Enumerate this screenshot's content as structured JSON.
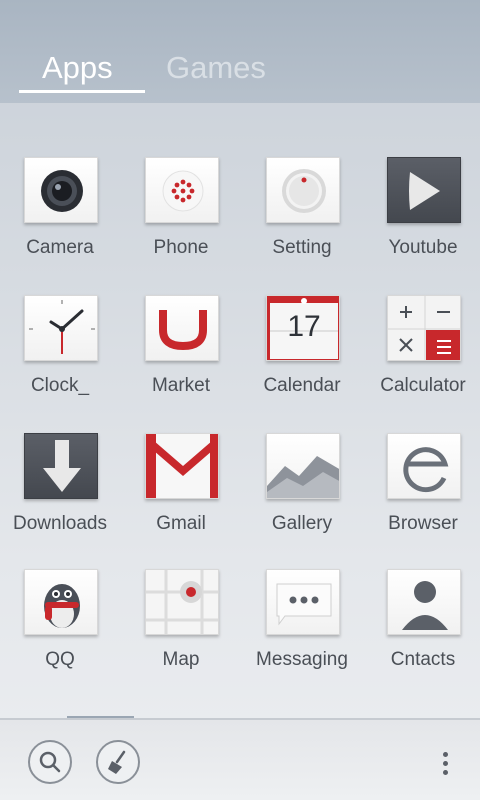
{
  "tabs": [
    {
      "label": "Apps",
      "active": true
    },
    {
      "label": "Games",
      "active": false
    }
  ],
  "apps": [
    {
      "label": "Camera",
      "icon": "camera-icon"
    },
    {
      "label": "Phone",
      "icon": "phone-icon"
    },
    {
      "label": "Setting",
      "icon": "settings-icon"
    },
    {
      "label": "Youtube",
      "icon": "youtube-icon"
    },
    {
      "label": "Clock_",
      "icon": "clock-icon"
    },
    {
      "label": "Market",
      "icon": "market-icon"
    },
    {
      "label": "Calendar",
      "icon": "calendar-icon",
      "day": "17"
    },
    {
      "label": "Calculator",
      "icon": "calculator-icon"
    },
    {
      "label": "Downloads",
      "icon": "downloads-icon"
    },
    {
      "label": "Gmail",
      "icon": "gmail-icon"
    },
    {
      "label": "Gallery",
      "icon": "gallery-icon"
    },
    {
      "label": "Browser",
      "icon": "browser-icon"
    },
    {
      "label": "QQ",
      "icon": "qq-icon"
    },
    {
      "label": "Map",
      "icon": "map-icon"
    },
    {
      "label": "Messaging",
      "icon": "messaging-icon"
    },
    {
      "label": "Cntacts",
      "icon": "contacts-icon"
    }
  ],
  "bottom_bar": {
    "search": "search-icon",
    "clean": "broom-icon",
    "menu": "more-vertical-icon"
  },
  "colors": {
    "accent_red": "#c8282c",
    "dark_tile": "#4f535b",
    "label": "#4a4f56"
  }
}
